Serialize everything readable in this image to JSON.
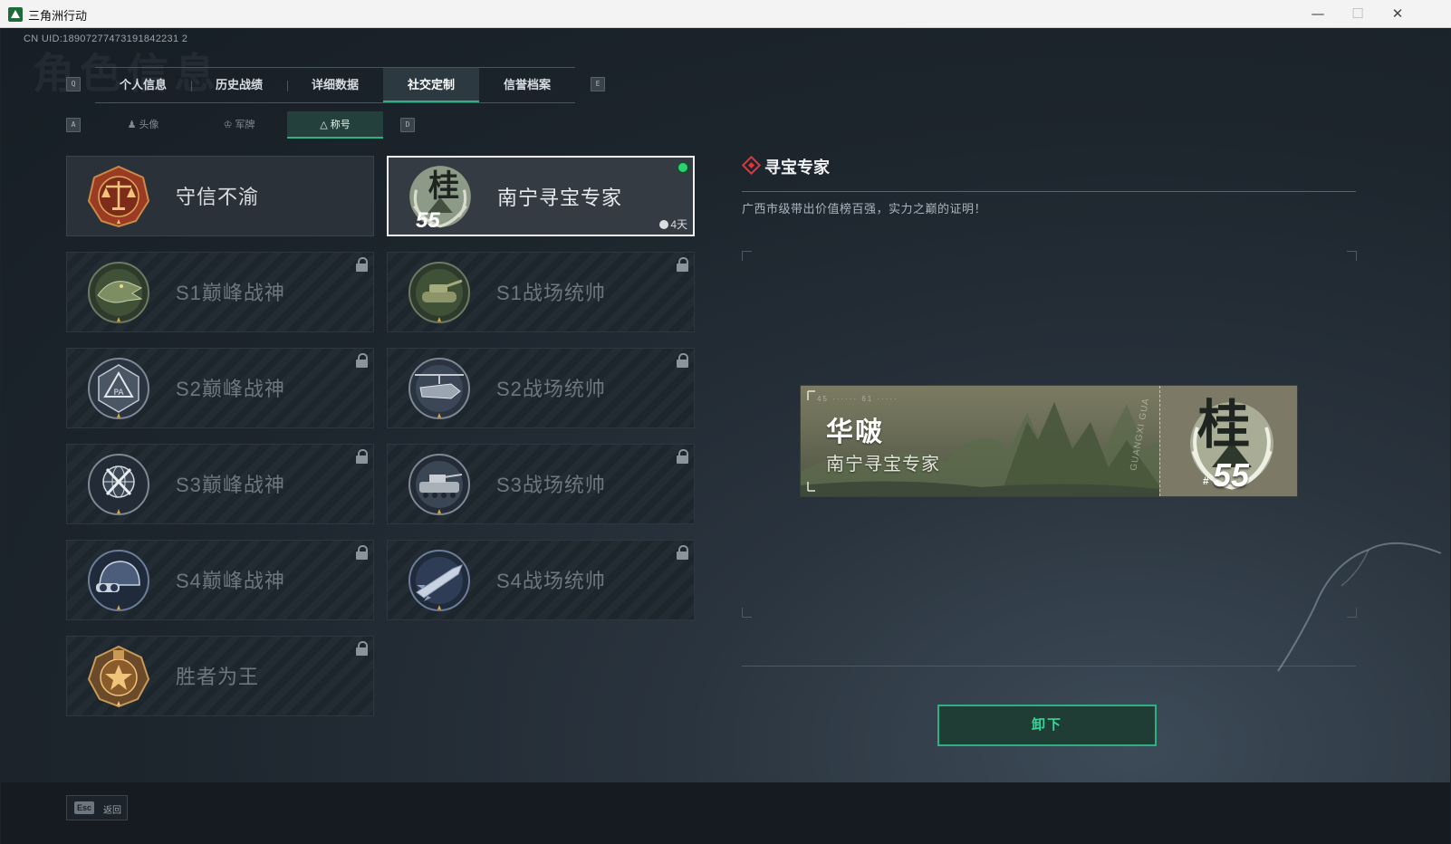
{
  "window": {
    "title": "三角洲行动",
    "minimize": "—",
    "maximize": "☐",
    "close": "✕"
  },
  "uid": "CN UID:18907277473191842231 2",
  "background_heading": "角色信息",
  "main_tabs": {
    "prev_key": "Q",
    "next_key": "E",
    "items": [
      {
        "label": "个人信息"
      },
      {
        "label": "历史战绩"
      },
      {
        "label": "详细数据"
      },
      {
        "label": "社交定制",
        "active": true
      },
      {
        "label": "信誉档案"
      }
    ]
  },
  "sub_tabs": {
    "prev_key": "A",
    "next_key": "D",
    "items": [
      {
        "label": "头像",
        "icon": "person-icon"
      },
      {
        "label": "军牌",
        "icon": "dogtag-icon"
      },
      {
        "label": "称号",
        "icon": "title-icon",
        "active": true
      }
    ]
  },
  "titles": [
    {
      "name": "守信不渝",
      "state": "unlocked",
      "emblem": "scales-badge-icon",
      "color": "#a8472a"
    },
    {
      "name": "南宁寻宝专家",
      "state": "equipped",
      "emblem": "gui-55-badge-icon",
      "badge_char": "桂",
      "badge_num": "55",
      "timer": "4天"
    },
    {
      "name": "S1巅峰战神",
      "state": "locked",
      "emblem": "crocodile-badge-icon"
    },
    {
      "name": "S1战场统帅",
      "state": "locked",
      "emblem": "tank-badge-icon"
    },
    {
      "name": "S2巅峰战神",
      "state": "locked",
      "emblem": "hex-pa-badge-icon"
    },
    {
      "name": "S2战场统帅",
      "state": "locked",
      "emblem": "helicopter-badge-icon"
    },
    {
      "name": "S3巅峰战神",
      "state": "locked",
      "emblem": "globe-badge-icon"
    },
    {
      "name": "S3战场统帅",
      "state": "locked",
      "emblem": "ifv-badge-icon"
    },
    {
      "name": "S4巅峰战神",
      "state": "locked",
      "emblem": "helmet-badge-icon"
    },
    {
      "name": "S4战场统帅",
      "state": "locked",
      "emblem": "missile-badge-icon"
    },
    {
      "name": "胜者为王",
      "state": "locked",
      "emblem": "medal-badge-icon"
    }
  ],
  "detail": {
    "title": "寻宝专家",
    "description": "广西市级带出价值榜百强，实力之巅的证明！"
  },
  "nameplate": {
    "player": "华啵",
    "title": "南宁寻宝专家",
    "side_text": "GUANGXI GUA",
    "badge_char": "桂",
    "badge_hash": "#",
    "badge_num": "55"
  },
  "action_button": "卸下",
  "footer": {
    "key": "Esc",
    "label": "返回"
  }
}
